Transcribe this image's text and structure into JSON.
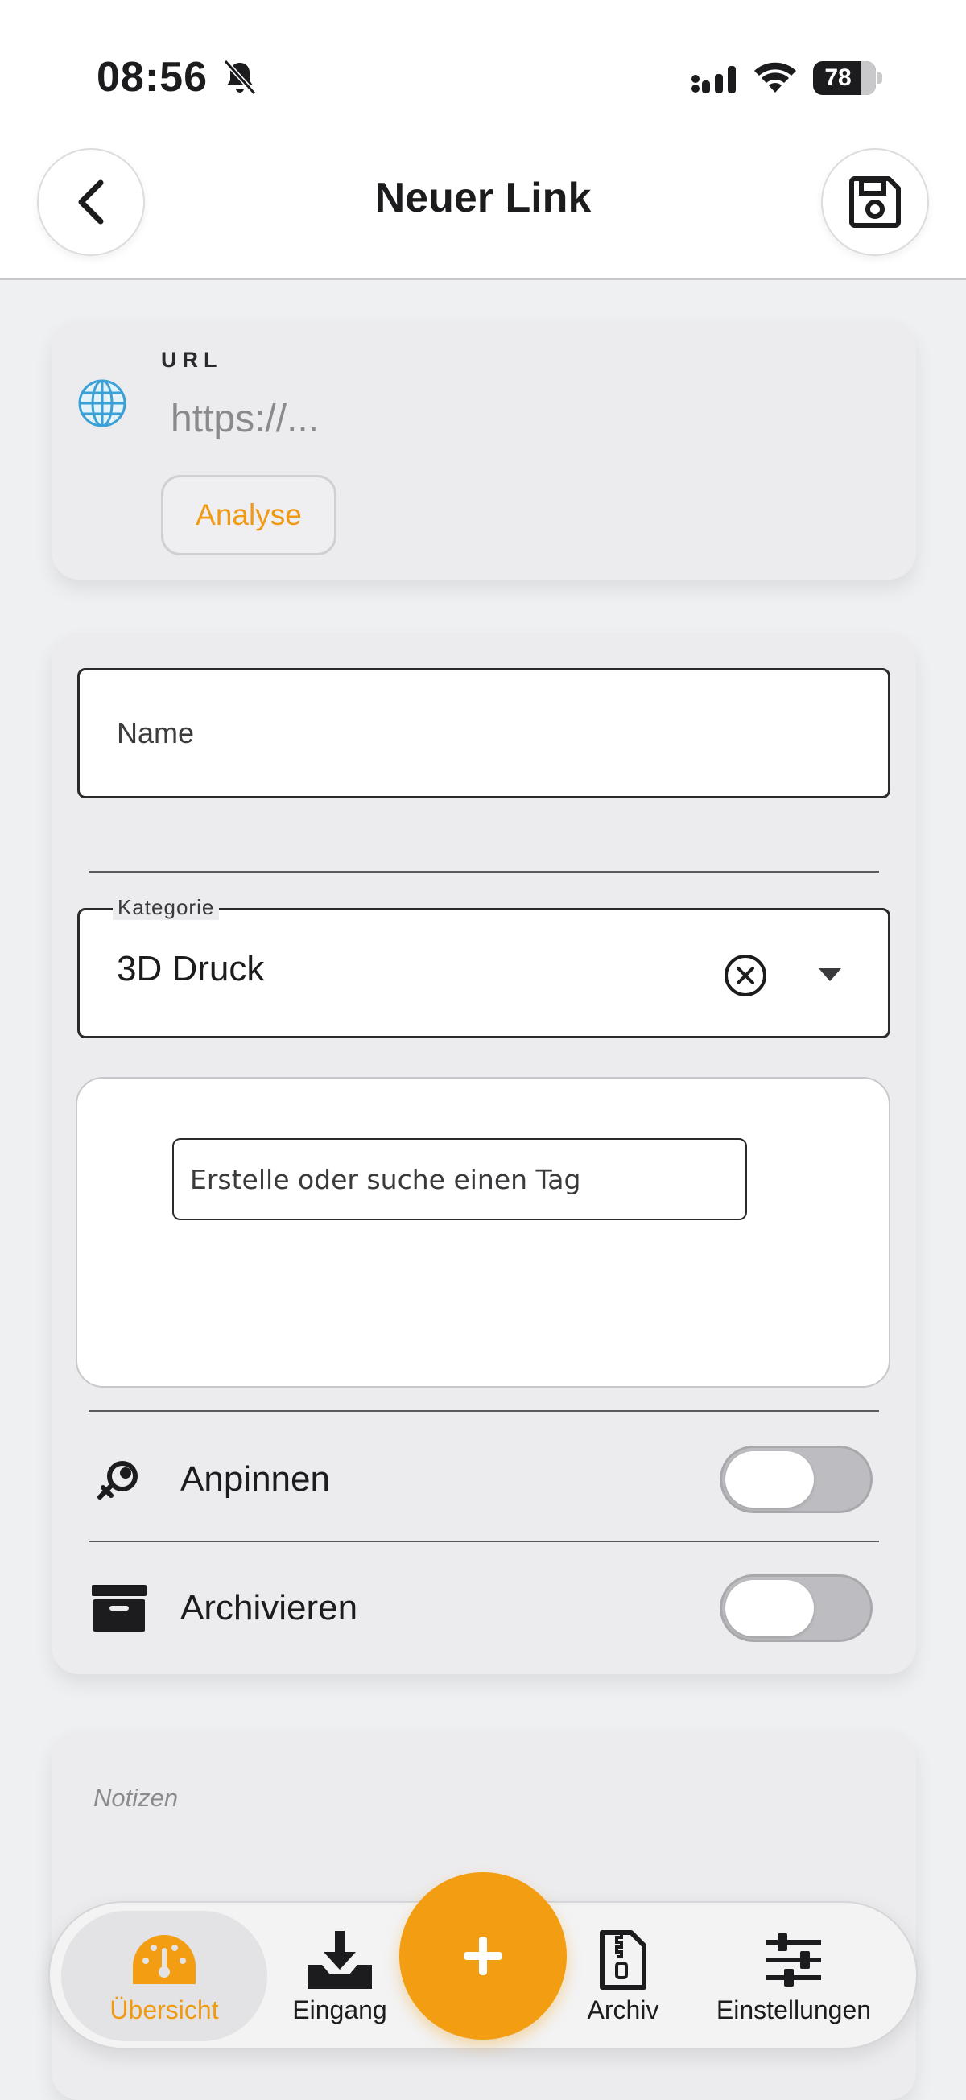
{
  "status_bar": {
    "time": "08:56",
    "battery": "78"
  },
  "header": {
    "title": "Neuer Link"
  },
  "url_card": {
    "label": "URL",
    "placeholder": "https://...",
    "analyse_label": "Analyse"
  },
  "form": {
    "name_placeholder": "Name",
    "category_label": "Kategorie",
    "category_value": "3D Druck",
    "tag_placeholder": "Erstelle oder suche einen Tag",
    "pin_label": "Anpinnen",
    "pin_on": false,
    "archive_label": "Archivieren",
    "archive_on": false
  },
  "notes": {
    "label": "Notizen"
  },
  "bottom_nav": {
    "items": [
      {
        "label": "Übersicht",
        "icon": "dashboard-icon",
        "active": true
      },
      {
        "label": "Eingang",
        "icon": "inbox-download-icon",
        "active": false
      },
      {
        "label": "Archiv",
        "icon": "zip-file-icon",
        "active": false
      },
      {
        "label": "Einstellungen",
        "icon": "sliders-icon",
        "active": false
      }
    ],
    "fab_icon": "plus-icon"
  },
  "colors": {
    "accent": "#F29D12",
    "background": "#EFF0F2",
    "card": "#ECECEE"
  }
}
